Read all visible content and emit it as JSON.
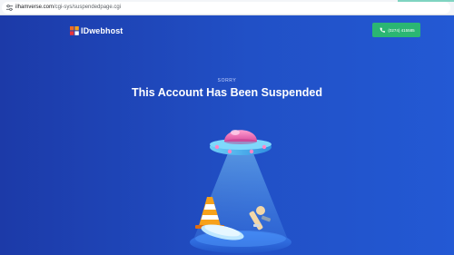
{
  "browser": {
    "url_host": "ilhamverse.com",
    "url_path": "/cgi-sys/suspendedpage.cgi"
  },
  "header": {
    "logo_text": "IDwebhost",
    "phone_label": "(0274) 415585"
  },
  "main": {
    "eyebrow": "SORRY",
    "title": "This Account Has Been Suspended"
  },
  "colors": {
    "background": "#1d44b8",
    "phone_button": "#2bb673",
    "logo_mark_orange": "#f26b21",
    "logo_mark_red": "#e8343a"
  },
  "icons": {
    "address_bar": "tune-icon",
    "phone": "phone-icon",
    "logo": "idwebhost-logo-icon",
    "illustration": "ufo-abduction-illustration"
  }
}
